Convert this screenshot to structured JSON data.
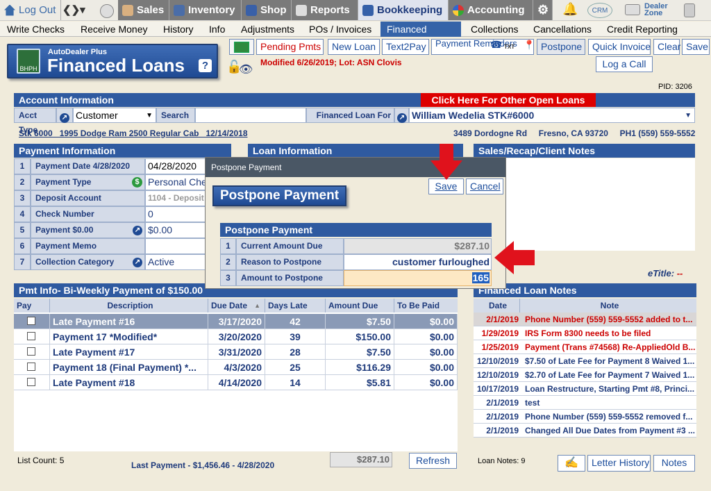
{
  "topnav": {
    "logout": "Log Out",
    "sales": "Sales",
    "inventory": "Inventory",
    "shop": "Shop",
    "reports": "Reports",
    "bookkeeping": "Bookkeeping",
    "accounting": "Accounting",
    "crm": "CRM",
    "dealer_zone": "Dealer Zone"
  },
  "subnav": {
    "items": [
      "Write Checks",
      "Receive Money",
      "History",
      "Info",
      "Adjustments",
      "POs / Invoices",
      "Financed Loans",
      "Collections",
      "Cancellations",
      "Credit Reporting"
    ],
    "active": "Financed Loans"
  },
  "logo": {
    "small": "AutoDealer Plus",
    "big": "Financed Loans",
    "badge": "BHPH",
    "help": "?"
  },
  "toolbar": {
    "pending": "Pending Pmts",
    "new_loan": "New Loan",
    "text2pay": "Text2Pay",
    "payment_reminders": "Payment Reminders",
    "txt": "TXT",
    "postpone": "Postpone",
    "quick_invoice": "Quick Invoice",
    "clear": "Clear",
    "save": "Save",
    "log_call": "Log a Call"
  },
  "modified": "Modified 6/26/2019; Lot: ASN Clovis",
  "pid": "PID: 3206",
  "account": {
    "header": "Account Information",
    "other_loans": "Click Here For Other Open Loans",
    "acct_type_label": "Acct Type",
    "acct_type": "Customer",
    "search_label": "Search",
    "search_value": "",
    "fl_for_label": "Financed Loan For",
    "fl_for": "William Wedelia STK#6000",
    "vehicle": "Stk 6000   1995 Dodge Ram 2500 Regular Cab   12/14/2018",
    "address": "3489 Dordogne Rd     Fresno, CA 93720     PH1 (559) 559-5552"
  },
  "payment": {
    "header": "Payment Information",
    "rows": [
      {
        "n": "1",
        "label": "Payment Date 4/28/2020",
        "value": "04/28/2020"
      },
      {
        "n": "2",
        "label": "Payment Type",
        "value": "Personal Check"
      },
      {
        "n": "3",
        "label": "Deposit Account",
        "value": "1104 - Deposit"
      },
      {
        "n": "4",
        "label": "Check Number",
        "value": "0"
      },
      {
        "n": "5",
        "label": "Payment $0.00",
        "value": "$0.00"
      },
      {
        "n": "6",
        "label": "Payment Memo",
        "value": ""
      },
      {
        "n": "7",
        "label": "Collection Category",
        "value": "Active"
      }
    ]
  },
  "loan_info": {
    "header": "Loan Information"
  },
  "notes_panel": {
    "header": "Sales/Recap/Client Notes",
    "etitle_label": "eTitle:",
    "etitle_value": "--"
  },
  "pmt_info": {
    "header": "Pmt Info- Bi-Weekly Payment of $150.00",
    "columns": [
      "Pay",
      "Description",
      "Due Date",
      "Days Late",
      "Amount Due",
      "To Be Paid"
    ],
    "rows": [
      {
        "desc": "Late Payment #16",
        "due": "3/17/2020",
        "late": "42",
        "amount": "$7.50",
        "paid": "$0.00"
      },
      {
        "desc": "Payment 17 *Modified*",
        "due": "3/20/2020",
        "late": "39",
        "amount": "$150.00",
        "paid": "$0.00"
      },
      {
        "desc": "Late Payment #17",
        "due": "3/31/2020",
        "late": "28",
        "amount": "$7.50",
        "paid": "$0.00"
      },
      {
        "desc": "Payment 18 (Final Payment) *...",
        "due": "4/3/2020",
        "late": "25",
        "amount": "$116.29",
        "paid": "$0.00"
      },
      {
        "desc": "Late Payment #18",
        "due": "4/14/2020",
        "late": "14",
        "amount": "$5.81",
        "paid": "$0.00"
      }
    ],
    "list_count": "List Count:  5",
    "last_payment": "Last Payment - $1,456.46 - 4/28/2020",
    "total": "$287.10",
    "refresh": "Refresh"
  },
  "fl_notes": {
    "header": "Financed Loan Notes",
    "columns": [
      "Date",
      "Note"
    ],
    "rows": [
      {
        "date": "2/1/2019",
        "note": "Phone Number (559) 559-5552 added to t...",
        "red": true
      },
      {
        "date": "1/29/2019",
        "note": "IRS Form 8300 needs to be filed",
        "red": true
      },
      {
        "date": "1/25/2019",
        "note": "Payment (Trans #74568) Re-AppliedOld B...",
        "red": true
      },
      {
        "date": "12/10/2019",
        "note": "$7.50 of Late Fee for Payment 8 Waived 1...",
        "red": false
      },
      {
        "date": "12/10/2019",
        "note": "$2.70 of Late Fee for Payment 7 Waived 1...",
        "red": false
      },
      {
        "date": "10/17/2019",
        "note": "Loan Restructure, Starting Pmt #8, Princi...",
        "red": false
      },
      {
        "date": "2/1/2019",
        "note": "test",
        "red": false
      },
      {
        "date": "2/1/2019",
        "note": "Phone Number (559) 559-5552 removed f...",
        "red": false
      },
      {
        "date": "2/1/2019",
        "note": "Changed All Due Dates from Payment #3 ...",
        "red": false
      }
    ],
    "count": "Loan Notes:  9",
    "letter_history": "Letter History",
    "notes": "Notes"
  },
  "modal": {
    "bar": "Postpone Payment",
    "title": "Postpone Payment",
    "save": "Save",
    "cancel": "Cancel",
    "section": "Postpone Payment",
    "rows": [
      {
        "n": "1",
        "label": "Current Amount Due",
        "value": "$287.10"
      },
      {
        "n": "2",
        "label": "Reason to Postpone",
        "value": "customer furloughed"
      },
      {
        "n": "3",
        "label": "Amount to Postpone",
        "value": "165"
      }
    ]
  },
  "colors": {
    "accent": "#2f5aa0",
    "red": "#cc0000",
    "arrow": "#e0121c"
  }
}
